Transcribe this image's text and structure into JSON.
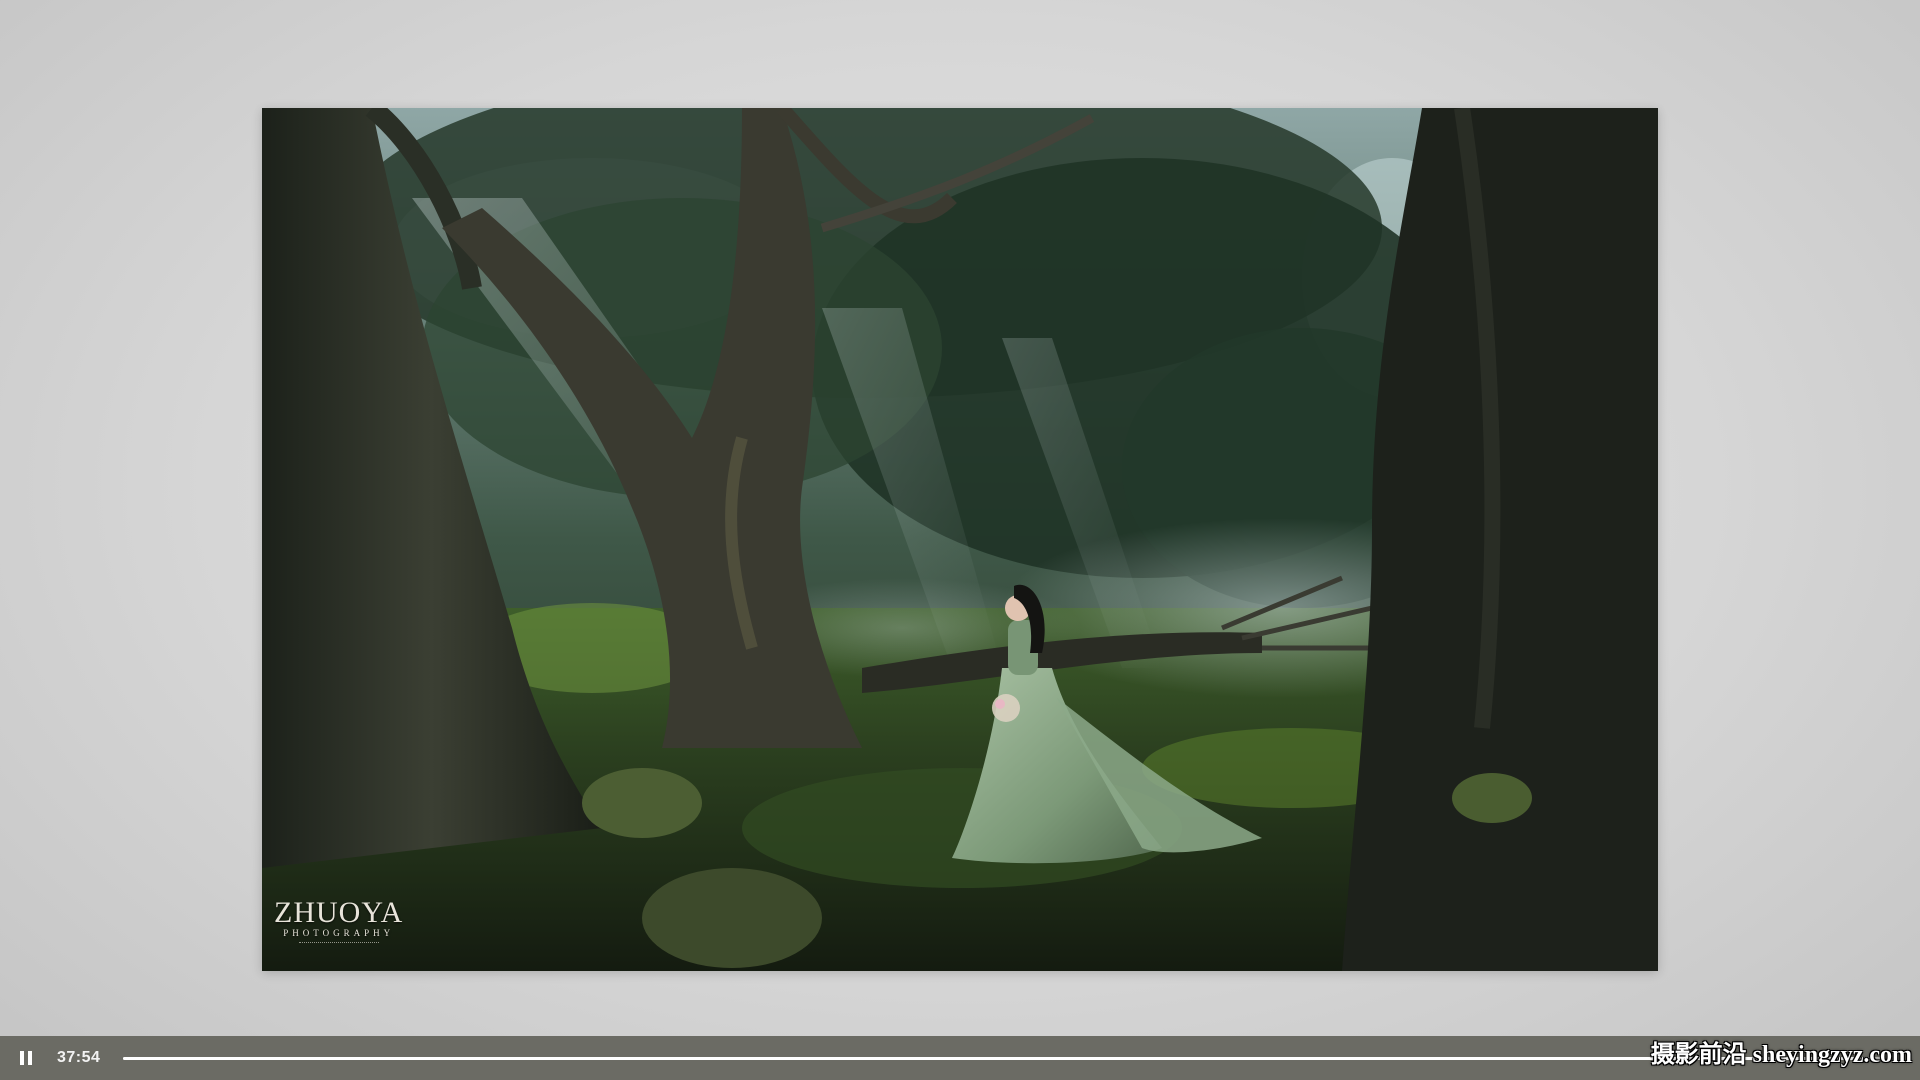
{
  "photo": {
    "watermark_brand": "ZHUOYA",
    "watermark_sub": "PHOTOGRAPHY"
  },
  "player": {
    "state_icon": "pause-icon",
    "current_time": "37:54",
    "progress_fraction": 0.995
  },
  "site_watermark": "摄影前沿 sheyingzyz.com",
  "colors": {
    "control_bar": "#6b6b64",
    "page_background": "#d6d6d6"
  }
}
